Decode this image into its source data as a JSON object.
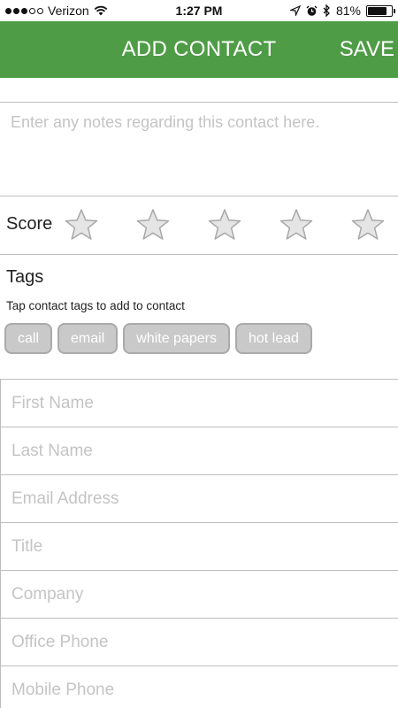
{
  "status_bar": {
    "carrier": "Verizon",
    "time": "1:27 PM",
    "battery": "81%",
    "battery_level": 0.81,
    "icons": [
      "signal-dots",
      "wifi-icon",
      "location-arrow-icon",
      "alarm-clock-icon",
      "bluetooth-icon",
      "battery-icon"
    ]
  },
  "header": {
    "title": "ADD CONTACT",
    "save_label": "SAVE",
    "background_color": "#4e9c45"
  },
  "notes": {
    "placeholder": "Enter any notes regarding this contact here.",
    "value": ""
  },
  "score": {
    "label": "Score",
    "max": 5,
    "value": 0
  },
  "tags": {
    "title": "Tags",
    "hint": "Tap contact tags to add to contact",
    "items": [
      "call",
      "email",
      "white papers",
      "hot lead"
    ]
  },
  "fields": {
    "first_name": "First Name",
    "last_name": "Last Name",
    "email": "Email Address",
    "title": "Title",
    "company": "Company",
    "office_phone": "Office Phone",
    "mobile_phone": "Mobile Phone"
  }
}
